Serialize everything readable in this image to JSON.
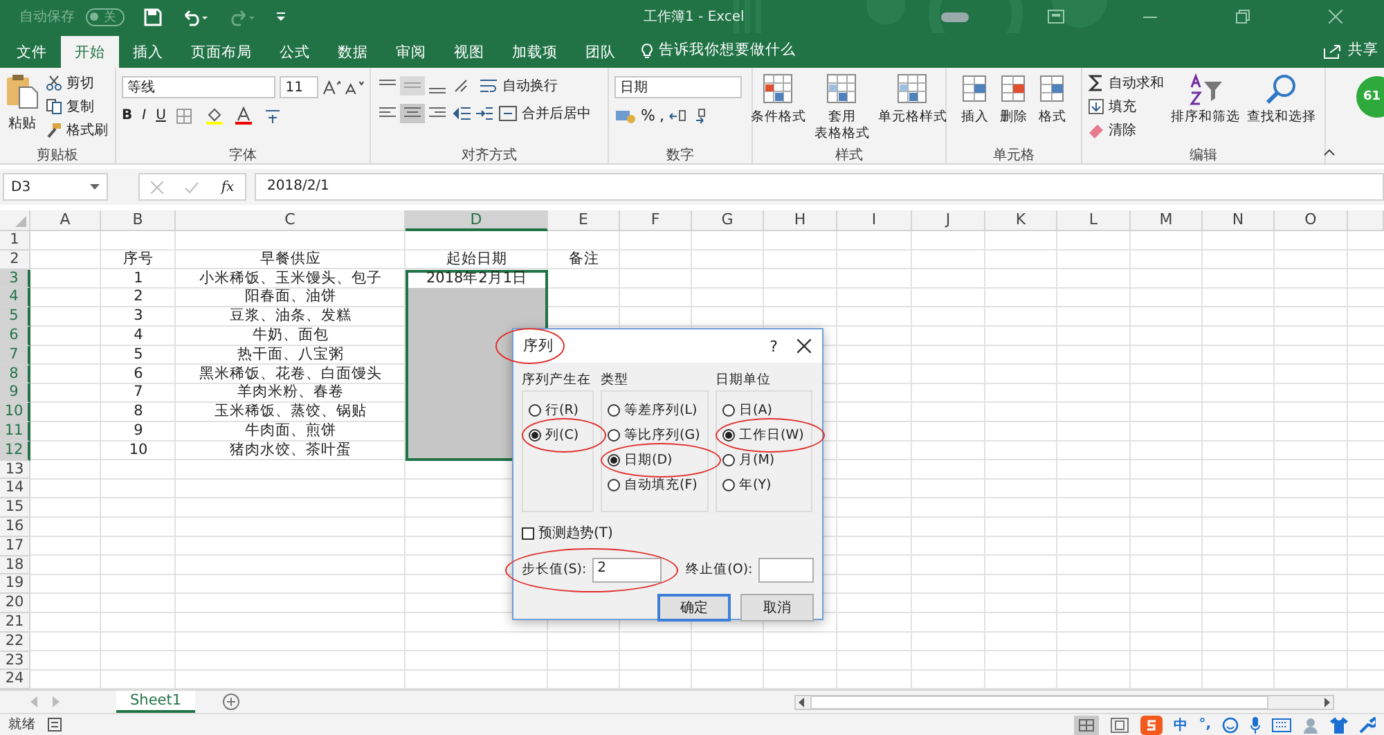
{
  "title_bar": {
    "autosave_label": "自动保存",
    "autosave_toggle": {
      "label": "关",
      "on": false
    },
    "title": "工作簿1 - Excel"
  },
  "menu_tabs": [
    {
      "label": "文件",
      "selected": false
    },
    {
      "label": "开始",
      "selected": true
    },
    {
      "label": "插入",
      "selected": false
    },
    {
      "label": "页面布局",
      "selected": false
    },
    {
      "label": "公式",
      "selected": false
    },
    {
      "label": "数据",
      "selected": false
    },
    {
      "label": "审阅",
      "selected": false
    },
    {
      "label": "视图",
      "selected": false
    },
    {
      "label": "加载项",
      "selected": false
    },
    {
      "label": "团队",
      "selected": false
    }
  ],
  "tell_me": "告诉我你想要做什么",
  "share": "共享",
  "ribbon": {
    "clipboard": {
      "label": "剪贴板",
      "paste": "粘贴",
      "cut": "剪切",
      "copy": "复制",
      "format_painter": "格式刷"
    },
    "font": {
      "label": "字体",
      "font_name": "等线",
      "font_size": "11",
      "bold": "B",
      "italic": "I",
      "underline": "U"
    },
    "alignment": {
      "label": "对齐方式",
      "wrap_text": "自动换行",
      "merge_center": "合并后居中"
    },
    "number": {
      "label": "数字",
      "format": "日期",
      "percent": "%",
      "comma": ","
    },
    "styles": {
      "label": "样式",
      "buttons": [
        {
          "lines": [
            "条件格式"
          ]
        },
        {
          "lines": [
            "套用",
            "表格格式"
          ]
        },
        {
          "lines": [
            "单元格样式"
          ]
        }
      ]
    },
    "cells": {
      "label": "单元格",
      "buttons": [
        "插入",
        "删除",
        "格式"
      ]
    },
    "editing": {
      "label": "编辑",
      "autosum": "自动求和",
      "fill": "填充",
      "clear": "清除",
      "sort_filter": "排序和筛选",
      "find_select": "查找和选择"
    },
    "badge": "61"
  },
  "formula_bar": {
    "name_box": "D3",
    "fx": "fx",
    "value": "2018/2/1"
  },
  "sheet": {
    "columns": [
      {
        "label": "A",
        "selected": false
      },
      {
        "label": "B",
        "selected": false
      },
      {
        "label": "C",
        "selected": false
      },
      {
        "label": "D",
        "selected": true
      },
      {
        "label": "E",
        "selected": false
      },
      {
        "label": "F",
        "selected": false
      },
      {
        "label": "G",
        "selected": false
      },
      {
        "label": "H",
        "selected": false
      },
      {
        "label": "I",
        "selected": false
      },
      {
        "label": "J",
        "selected": false
      },
      {
        "label": "K",
        "selected": false
      },
      {
        "label": "L",
        "selected": false
      },
      {
        "label": "M",
        "selected": false
      },
      {
        "label": "N",
        "selected": false
      },
      {
        "label": "O",
        "selected": false
      }
    ],
    "rows": [
      {
        "number": "1",
        "selected": false
      },
      {
        "number": "2",
        "selected": false,
        "b": "序号",
        "c": "早餐供应",
        "d": "起始日期",
        "e": "备注"
      },
      {
        "number": "3",
        "selected": true,
        "b": "1",
        "c": "小米稀饭、玉米馒头、包子",
        "d": {
          "text": "2018年2月1日",
          "selected": true,
          "active": true
        }
      },
      {
        "number": "4",
        "selected": true,
        "b": "2",
        "c": "阳春面、油饼",
        "d": {
          "selected": true,
          "active": false
        }
      },
      {
        "number": "5",
        "selected": true,
        "b": "3",
        "c": "豆浆、油条、发糕",
        "d": {
          "selected": true,
          "active": false
        }
      },
      {
        "number": "6",
        "selected": true,
        "b": "4",
        "c": "牛奶、面包",
        "d": {
          "selected": true,
          "active": false
        }
      },
      {
        "number": "7",
        "selected": true,
        "b": "5",
        "c": "热干面、八宝粥",
        "d": {
          "selected": true,
          "active": false
        }
      },
      {
        "number": "8",
        "selected": true,
        "b": "6",
        "c": "黑米稀饭、花卷、白面馒头",
        "d": {
          "selected": true,
          "active": false
        }
      },
      {
        "number": "9",
        "selected": true,
        "b": "7",
        "c": "羊肉米粉、春卷",
        "d": {
          "selected": true,
          "active": false
        }
      },
      {
        "number": "10",
        "selected": true,
        "b": "8",
        "c": "玉米稀饭、蒸饺、锅贴",
        "d": {
          "selected": true,
          "active": false
        }
      },
      {
        "number": "11",
        "selected": true,
        "b": "9",
        "c": "牛肉面、煎饼",
        "d": {
          "selected": true,
          "active": false
        }
      },
      {
        "number": "12",
        "selected": true,
        "b": "10",
        "c": "猪肉水饺、茶叶蛋",
        "d": {
          "selected": true,
          "active": false
        }
      },
      {
        "number": "13",
        "selected": false
      },
      {
        "number": "14",
        "selected": false
      },
      {
        "number": "15",
        "selected": false
      },
      {
        "number": "16",
        "selected": false
      },
      {
        "number": "17",
        "selected": false
      },
      {
        "number": "18",
        "selected": false
      },
      {
        "number": "19",
        "selected": false
      },
      {
        "number": "20",
        "selected": false
      },
      {
        "number": "21",
        "selected": false
      },
      {
        "number": "22",
        "selected": false
      },
      {
        "number": "23",
        "selected": false
      },
      {
        "number": "24",
        "selected": false
      }
    ]
  },
  "dialog": {
    "title": {
      "text": "序列",
      "circled": true
    },
    "help": "?",
    "groups": [
      {
        "label": "序列产生在",
        "options": [
          {
            "label": "行(R)",
            "selected": false,
            "circled": false
          },
          {
            "label": "列(C)",
            "selected": true,
            "circled": true
          }
        ]
      },
      {
        "label": "类型",
        "options": [
          {
            "label": "等差序列(L)",
            "selected": false,
            "circled": false
          },
          {
            "label": "等比序列(G)",
            "selected": false,
            "circled": false
          },
          {
            "label": "日期(D)",
            "selected": true,
            "circled": true
          },
          {
            "label": "自动填充(F)",
            "selected": false,
            "circled": false
          }
        ]
      },
      {
        "label": "日期单位",
        "options": [
          {
            "label": "日(A)",
            "selected": false,
            "circled": false
          },
          {
            "label": "工作日(W)",
            "selected": true,
            "circled": true
          },
          {
            "label": "月(M)",
            "selected": false,
            "circled": false
          },
          {
            "label": "年(Y)",
            "selected": false,
            "circled": false
          }
        ]
      }
    ],
    "trend": {
      "label": "预测趋势(T)",
      "checked": false
    },
    "step": {
      "label": "步长值(S):",
      "value": "2",
      "circled": true
    },
    "stop": {
      "label": "终止值(O):"
    },
    "buttons": [
      {
        "label": "确定",
        "default": true
      },
      {
        "label": "取消",
        "default": false
      }
    ]
  },
  "sheet_tabs": [
    {
      "label": "Sheet1",
      "selected": true
    }
  ],
  "status_bar": {
    "ready": "就绪",
    "ime_mode": "中",
    "ime_punct": "°,"
  }
}
